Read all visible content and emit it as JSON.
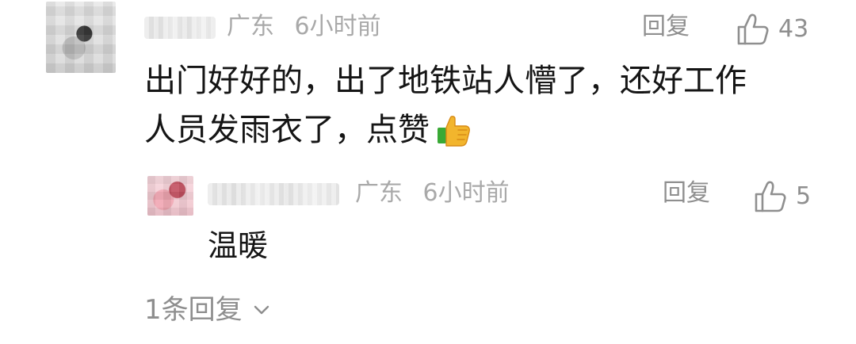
{
  "comment": {
    "location": "广东",
    "time": "6小时前",
    "reply_label": "回复",
    "like_count": "43",
    "text_line1": "出门好好的，出了地铁站人懵了，还好工作",
    "text_line2": "人员发雨衣了，点赞",
    "emoji": "thumbs-up-emoji"
  },
  "reply": {
    "location": "广东",
    "time": "6小时前",
    "reply_label": "回复",
    "like_count": "5",
    "text": "温暖"
  },
  "more_replies_label": "1条回复",
  "icons": {
    "like": "thumb-up-outline",
    "expand": "chevron-down"
  },
  "colors": {
    "meta": "#a9a9a9",
    "action": "#8f8f8f",
    "text": "#151515"
  }
}
